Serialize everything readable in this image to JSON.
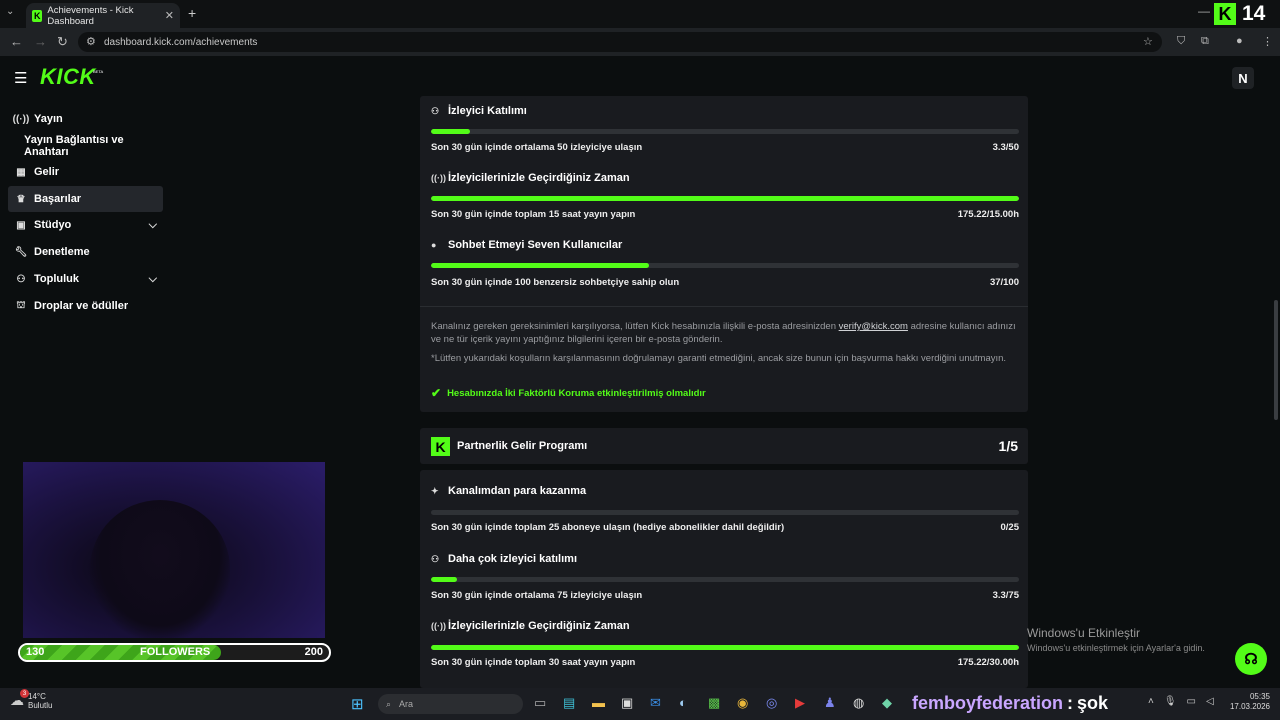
{
  "browser": {
    "tab_title": "Achievements - Kick Dashboard",
    "tab_close": "✕",
    "new_tab": "+",
    "url": "dashboard.kick.com/achievements",
    "overlay_count": "14",
    "favicon_letter": "K"
  },
  "header": {
    "logo": "KICK",
    "beta": "BETA",
    "user_initial": "N"
  },
  "sidebar": {
    "items": [
      {
        "label": "Yayın",
        "icon": "broadcast-icon"
      },
      {
        "label": "Yayın Bağlantısı ve Anahtarı",
        "icon": ""
      },
      {
        "label": "Gelir",
        "icon": "chart-icon"
      },
      {
        "label": "Başarılar",
        "icon": "trophy-icon"
      },
      {
        "label": "Stüdyo",
        "icon": "studio-icon"
      },
      {
        "label": "Denetleme",
        "icon": "wrench-icon"
      },
      {
        "label": "Topluluk",
        "icon": "community-icon"
      },
      {
        "label": "Droplar ve ödüller",
        "icon": "gift-icon"
      }
    ]
  },
  "affiliate": {
    "sections": [
      {
        "title": "İzleyici Katılımı",
        "requirement": "Son 30 gün içinde ortalama 50 izleyiciye ulaşın",
        "value": "3.3/50",
        "progress": 0.066
      },
      {
        "title": "İzleyicilerinizle Geçirdiğiniz Zaman",
        "requirement": "Son 30 gün içinde toplam 15 saat yayın yapın",
        "value": "175.22/15.00h",
        "progress": 1.0
      },
      {
        "title": "Sohbet Etmeyi Seven Kullanıcılar",
        "requirement": "Son 30 gün içinde 100 benzersiz sohbetçiye sahip olun",
        "value": "37/100",
        "progress": 0.37
      }
    ],
    "note1_a": "Kanalınız gereken gereksinimleri karşılıyorsa, lütfen Kick hesabınızla ilişkili e-posta adresinizden ",
    "note1_link": "verify@kick.com",
    "note1_b": " adresine kullanıcı adınızı ve ne tür içerik yayını yaptığınız bilgilerini içeren bir e-posta gönderin.",
    "note2": "*Lütfen yukarıdaki koşulların karşılanmasının doğrulamayı garanti etmediğini, ancak size bunun için başvurma hakkı verdiğini unutmayın.",
    "twofa": "Hesabınızda İki Faktörlü Koruma etkinleştirilmiş olmalıdır"
  },
  "partner": {
    "title": "Partnerlik Gelir Programı",
    "count": "1/5",
    "sections": [
      {
        "title": "Kanalımdan para kazanma",
        "requirement": "Son 30 gün içinde toplam 25 aboneye ulaşın (hediye abonelikler dahil değildir)",
        "value": "0/25",
        "progress": 0.0
      },
      {
        "title": "Daha çok izleyici katılımı",
        "requirement": "Son 30 gün içinde ortalama 75 izleyiciye ulaşın",
        "value": "3.3/75",
        "progress": 0.044
      },
      {
        "title": "İzleyicilerinizle Geçirdiğiniz Zaman",
        "requirement": "Son 30 gün içinde toplam 30 saat yayın yapın",
        "value": "175.22/30.00h",
        "progress": 1.0
      }
    ]
  },
  "followers": {
    "current": "130",
    "label": "FOLLOWERS",
    "goal": "200",
    "progress": 0.65
  },
  "windows_activation": {
    "title": "Windows'u Etkinleştir",
    "subtitle": "Windows'u etkinleştirmek için Ayarlar'a gidin."
  },
  "taskbar": {
    "temp": "14°C",
    "weather": "Bulutlu",
    "weather_badge": "3",
    "search": "Ara",
    "chat_user": "femboyfederation",
    "chat_sep": ":",
    "chat_msg": "şok",
    "time": "05:35",
    "date": "17.03.2026"
  },
  "colors": {
    "accent": "#53fc18",
    "bg": "#0b0e0f",
    "card": "#191b1f"
  }
}
